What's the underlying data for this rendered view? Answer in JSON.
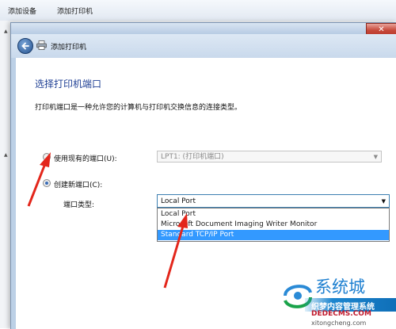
{
  "background_window": {
    "toolbar": {
      "add_device": "添加设备",
      "add_printer": "添加打印机"
    }
  },
  "dialog": {
    "title": "添加打印机",
    "close_glyph": "✕",
    "section_title": "选择打印机端口",
    "description": "打印机端口是一种允许您的计算机与打印机交换信息的连接类型。",
    "use_existing": {
      "label": "使用现有的端口(U):",
      "value": "LPT1: (打印机端口)",
      "checked": false
    },
    "create_new": {
      "label": "创建新端口(C):",
      "checked": true
    },
    "port_type": {
      "label": "端口类型:",
      "value": "Local Port",
      "options": [
        "Local Port",
        "Microsoft Document Imaging Writer Monitor",
        "Standard TCP/IP Port"
      ],
      "highlighted": "Standard TCP/IP Port"
    }
  },
  "watermark": {
    "logo_text": "系统城",
    "line1": "织梦内容管理系统",
    "line2": "DEDECMS.COM",
    "line3": "xitongcheng.com"
  },
  "colors": {
    "accent_blue": "#1f3f94",
    "highlight": "#3399ff",
    "arrow_red": "#e3261b"
  }
}
